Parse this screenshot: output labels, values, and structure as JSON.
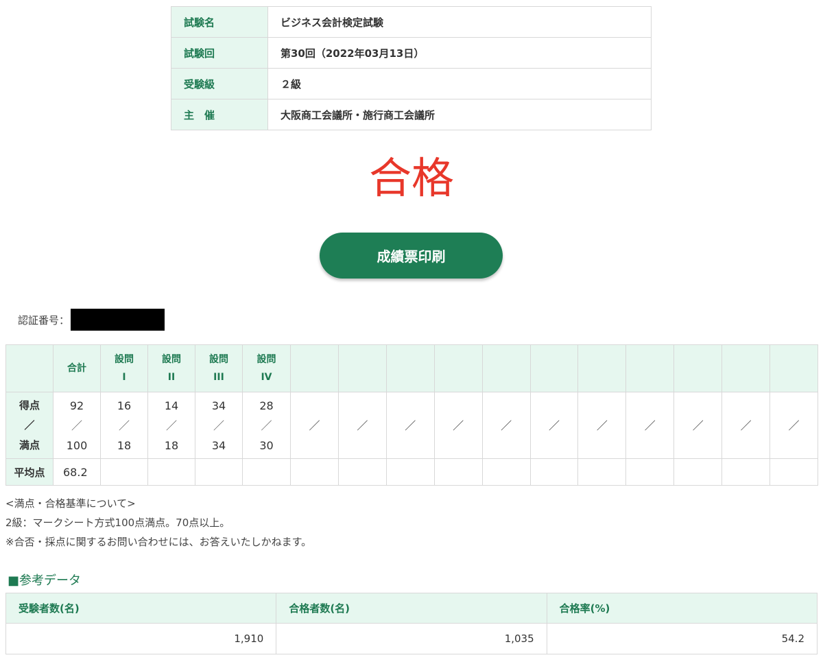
{
  "exam_info": [
    {
      "label": "試験名",
      "value": "ビジネス会計検定試験"
    },
    {
      "label": "試験回",
      "value": "第30回（2022年03月13日）"
    },
    {
      "label": "受験級",
      "value": "２級"
    },
    {
      "label": "主　催",
      "value": "大阪商工会議所・施行商工会議所"
    }
  ],
  "result": "合格",
  "print_button": "成績票印刷",
  "cert_label": "認証番号：",
  "score_table": {
    "headers": [
      "",
      "合計",
      "設問\nI",
      "設問\nII",
      "設問\nIII",
      "設問\nIV",
      "",
      "",
      "",
      "",
      "",
      "",
      "",
      "",
      "",
      "",
      ""
    ],
    "row_label_top": "得点",
    "row_label_mid": "／",
    "row_label_bottom": "満点",
    "scores": [
      {
        "got": "92",
        "max": "100"
      },
      {
        "got": "16",
        "max": "18"
      },
      {
        "got": "14",
        "max": "18"
      },
      {
        "got": "34",
        "max": "34"
      },
      {
        "got": "28",
        "max": "30"
      }
    ],
    "slash": "／",
    "empty_columns": 11,
    "avg_label": "平均点",
    "avg_value": "68.2"
  },
  "notes": [
    "<満点・合格基準について>",
    "2級：マークシート方式100点満点。70点以上。",
    "※合否・採点に関するお問い合わせには、お答えいたしかねます。"
  ],
  "reference": {
    "title": "■参考データ",
    "headers": [
      "受験者数(名)",
      "合格者数(名)",
      "合格率(%)"
    ],
    "values": [
      "1,910",
      "1,035",
      "54.2"
    ]
  },
  "colors": {
    "accent_green": "#1e7e55",
    "header_bg": "#e6f7ef",
    "pass_red": "#e8372a"
  }
}
